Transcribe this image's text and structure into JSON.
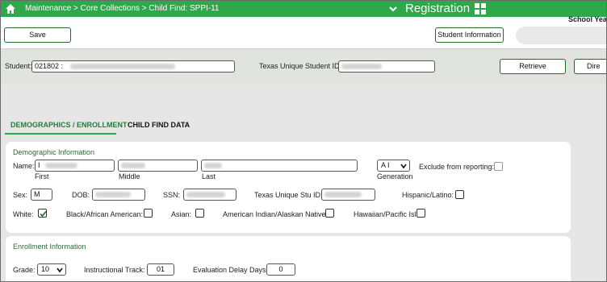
{
  "topbar": {
    "breadcrumb": "Maintenance > Core Collections > Child Find: SPPI-11",
    "title": "Registration",
    "icons": {
      "home": "home-icon",
      "chevron": "chevron-down-icon",
      "grid": "app-grid-icon"
    },
    "color": "#2ea84a"
  },
  "toolbar": {
    "save_label": "Save",
    "student_info_label": "Student Information",
    "school_year_label": "School Year:"
  },
  "student_bar": {
    "student_label": "Student:",
    "student_value": "021802 :",
    "tsds_label": "Texas Unique Student ID:",
    "retrieve_label": "Retrieve",
    "directory_label": "Dire"
  },
  "tabs": [
    {
      "label": "DEMOGRAPHICS / ENROLLMENT",
      "active": true
    },
    {
      "label": "CHILD FIND DATA",
      "active": false
    }
  ],
  "demographic": {
    "section_title": "Demographic Information",
    "name_label": "Name:",
    "first_value": "I",
    "first_caption": "First",
    "middle_caption": "Middle",
    "last_caption": "Last",
    "generation_value": "A I",
    "generation_caption": "Generation",
    "exclude_label": "Exclude from reporting:",
    "exclude_checked": false,
    "sex_label": "Sex:",
    "sex_value": "M",
    "dob_label": "DOB:",
    "ssn_label": "SSN:",
    "tsds_label": "Texas Unique Stu ID:",
    "hispanic_label": "Hispanic/Latino:",
    "hispanic_checked": false,
    "white_label": "White:",
    "white_checked": true,
    "black_label": "Black/African American:",
    "black_checked": false,
    "asian_label": "Asian:",
    "asian_checked": false,
    "american_indian_label": "American Indian/Alaskan Native:",
    "american_indian_checked": false,
    "hawaiian_label": "Hawaiian/Pacific Isl:",
    "hawaiian_checked": false
  },
  "enrollment": {
    "section_title": "Enrollment Information",
    "grade_label": "Grade:",
    "grade_value": "10",
    "track_label": "Instructional Track:",
    "track_value": "01",
    "delay_label": "Evaluation Delay Days:",
    "delay_value": "0"
  },
  "colors": {
    "accent": "#2ea84a",
    "section_title": "#2a6b35",
    "background": "#e6e6e6"
  }
}
